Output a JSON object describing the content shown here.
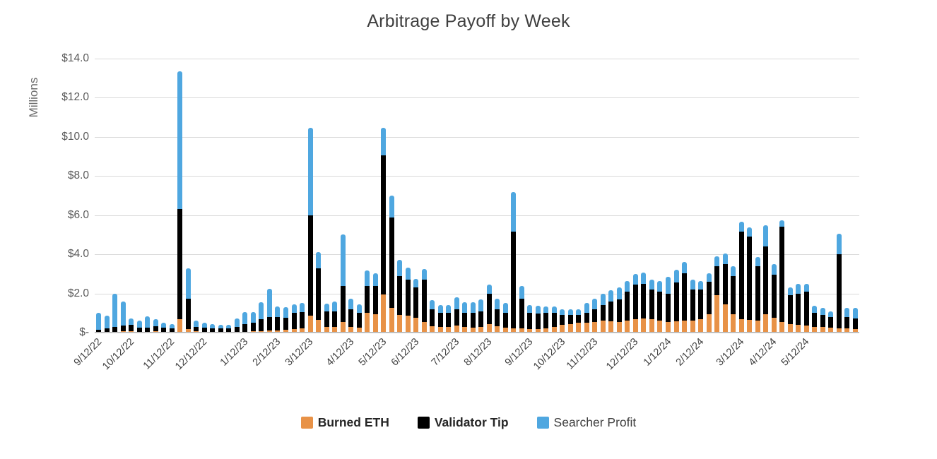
{
  "chart_data": {
    "type": "bar",
    "subtype": "stacked-bar",
    "title": "Arbitrage Payoff by Week",
    "xlabel": "",
    "ylabel": "Millions",
    "ylim": [
      0,
      14
    ],
    "ytick_labels": [
      "$-",
      "$2.0",
      "$4.0",
      "$6.0",
      "$8.0",
      "$10.0",
      "$12.0",
      "$14.0"
    ],
    "ytick_values": [
      0,
      2,
      4,
      6,
      8,
      10,
      12,
      14
    ],
    "grid": true,
    "legend_position": "bottom",
    "colors": {
      "burned_eth": "#E89247",
      "validator_tip": "#000000",
      "searcher_profit": "#4FA7E0",
      "gridline": "#d9d9d9",
      "title_text": "#3f3f3f",
      "axis_text": "#595959"
    },
    "xtick_labels": [
      "9/12/22",
      "10/12/22",
      "11/12/22",
      "12/12/22",
      "1/12/23",
      "2/12/23",
      "3/12/23",
      "4/12/23",
      "5/12/23",
      "6/12/23",
      "7/12/23",
      "8/12/23",
      "9/12/23",
      "10/12/23",
      "11/12/23",
      "12/12/23",
      "1/12/24",
      "2/12/24",
      "3/12/24",
      "4/12/24",
      "5/12/24"
    ],
    "xtick_bar_indices": [
      0,
      4,
      9,
      13,
      18,
      22,
      26,
      31,
      35,
      39,
      44,
      48,
      53,
      57,
      61,
      66,
      70,
      74,
      79,
      83,
      87
    ],
    "series": [
      {
        "name": "Burned ETH",
        "color": "#E89247",
        "values": [
          0.04,
          0.05,
          0.05,
          0.06,
          0.06,
          0.05,
          0.05,
          0.06,
          0.05,
          0.05,
          0.7,
          0.18,
          0.06,
          0.05,
          0.04,
          0.04,
          0.04,
          0.05,
          0.05,
          0.06,
          0.08,
          0.1,
          0.12,
          0.13,
          0.18,
          0.2,
          0.85,
          0.65,
          0.3,
          0.28,
          0.55,
          0.3,
          0.25,
          1.0,
          0.95,
          1.95,
          1.25,
          0.9,
          0.85,
          0.75,
          0.55,
          0.32,
          0.28,
          0.3,
          0.35,
          0.3,
          0.25,
          0.28,
          0.42,
          0.32,
          0.25,
          0.22,
          0.2,
          0.18,
          0.18,
          0.22,
          0.3,
          0.4,
          0.45,
          0.5,
          0.5,
          0.55,
          0.6,
          0.58,
          0.55,
          0.6,
          0.7,
          0.72,
          0.68,
          0.6,
          0.55,
          0.58,
          0.6,
          0.62,
          0.7,
          0.95,
          1.9,
          1.45,
          0.95,
          0.7,
          0.65,
          0.6,
          0.95,
          0.75,
          0.55,
          0.45,
          0.4,
          0.35,
          0.3,
          0.28,
          0.25,
          0.22,
          0.2,
          0.18
        ]
      },
      {
        "name": "Validator Tip",
        "color": "#000000",
        "values": [
          0.11,
          0.18,
          0.25,
          0.3,
          0.35,
          0.22,
          0.2,
          0.28,
          0.2,
          0.18,
          5.6,
          1.55,
          0.24,
          0.2,
          0.16,
          0.16,
          0.16,
          0.25,
          0.4,
          0.44,
          0.62,
          0.7,
          0.68,
          0.62,
          0.82,
          0.85,
          5.15,
          2.65,
          0.78,
          0.82,
          1.85,
          0.9,
          0.75,
          1.4,
          1.45,
          7.1,
          4.65,
          2.0,
          1.85,
          1.55,
          2.15,
          0.88,
          0.72,
          0.7,
          0.85,
          0.7,
          0.75,
          0.82,
          1.58,
          0.88,
          0.75,
          4.95,
          1.55,
          0.82,
          0.8,
          0.78,
          0.7,
          0.5,
          0.45,
          0.4,
          0.5,
          0.65,
          0.8,
          1.02,
          1.15,
          1.5,
          1.75,
          1.78,
          1.52,
          1.5,
          1.45,
          2.0,
          2.42,
          1.58,
          1.5,
          1.65,
          1.5,
          2.05,
          1.95,
          4.45,
          4.25,
          2.8,
          3.45,
          2.2,
          4.85,
          1.45,
          1.6,
          1.75,
          0.7,
          0.62,
          0.55,
          3.8,
          0.6,
          0.55
        ]
      },
      {
        "name": "Searcher Profit",
        "color": "#4FA7E0",
        "values": [
          0.85,
          0.62,
          1.7,
          1.22,
          0.3,
          0.33,
          0.58,
          0.36,
          0.25,
          0.22,
          7.05,
          1.55,
          0.3,
          0.25,
          0.22,
          0.2,
          0.2,
          0.42,
          0.6,
          0.55,
          0.85,
          1.45,
          0.55,
          0.55,
          0.45,
          0.45,
          4.45,
          0.8,
          0.4,
          0.5,
          2.6,
          0.55,
          0.45,
          0.78,
          0.65,
          1.4,
          1.1,
          0.8,
          0.62,
          0.45,
          0.55,
          0.45,
          0.4,
          0.42,
          0.6,
          0.55,
          0.55,
          0.6,
          0.45,
          0.55,
          0.5,
          2.0,
          0.62,
          0.42,
          0.38,
          0.32,
          0.35,
          0.3,
          0.28,
          0.28,
          0.5,
          0.55,
          0.6,
          0.55,
          0.6,
          0.52,
          0.55,
          0.55,
          0.5,
          0.52,
          0.85,
          0.62,
          0.6,
          0.52,
          0.45,
          0.42,
          0.5,
          0.55,
          0.5,
          0.5,
          0.48,
          0.45,
          1.1,
          0.55,
          0.35,
          0.42,
          0.5,
          0.4,
          0.38,
          0.35,
          0.3,
          1.05,
          0.45,
          0.55
        ]
      }
    ]
  },
  "legend": {
    "items": [
      {
        "label": "Burned ETH",
        "color": "#E89247",
        "bold": true
      },
      {
        "label": "Validator Tip",
        "color": "#000000",
        "bold": true
      },
      {
        "label": "Searcher Profit",
        "color": "#4FA7E0",
        "bold": false
      }
    ]
  }
}
